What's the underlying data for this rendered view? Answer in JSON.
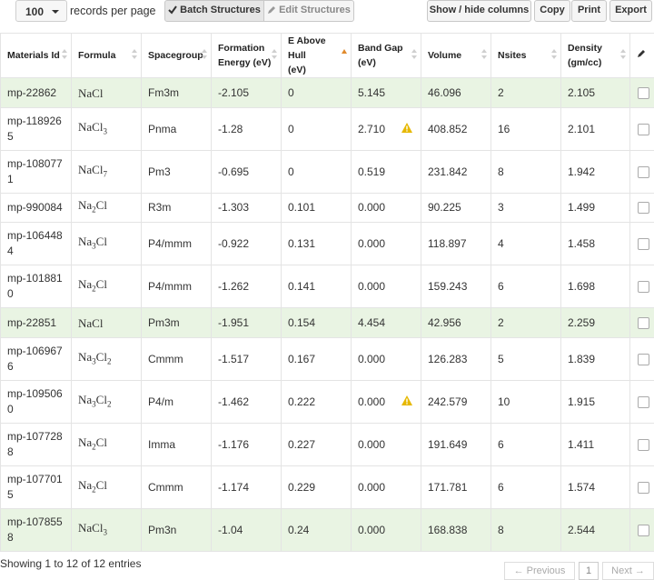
{
  "toolbar": {
    "page_length": "100",
    "page_length_label": "records per page",
    "batch_label": "Batch Structures",
    "edit_label": "Edit Structures",
    "columns_label": "Show / hide columns",
    "copy_label": "Copy",
    "print_label": "Print",
    "export_label": "Export"
  },
  "headers": {
    "id": "Materials Id",
    "formula": "Formula",
    "spacegroup": "Spacegroup",
    "formation1": "Formation",
    "formation2": "Energy (eV)",
    "ehull1": "E Above Hull",
    "ehull2": "(eV)",
    "gap1": "Band Gap",
    "gap2": "(eV)",
    "volume": "Volume",
    "nsites": "Nsites",
    "density1": "Density",
    "density2": "(gm/cc)"
  },
  "colors": {
    "highlight_row": "#e9f4e3",
    "sort_active": "#e08a2c",
    "warning": "#e6b800"
  },
  "rows": [
    {
      "id1": "mp-22862",
      "id2": "",
      "el1": "NaCl",
      "s1": "",
      "el2": "",
      "s2": "",
      "sg": "Fm3m",
      "fe": "-2.105",
      "eh": "0",
      "bg": "5.145",
      "warn": false,
      "vol": "46.096",
      "ns": "2",
      "den": "2.105",
      "hl": true
    },
    {
      "id1": "mp-118926",
      "id2": "5",
      "el1": "NaCl",
      "s1": "3",
      "el2": "",
      "s2": "",
      "sg": "Pnma",
      "fe": "-1.28",
      "eh": "0",
      "bg": "2.710",
      "warn": true,
      "vol": "408.852",
      "ns": "16",
      "den": "2.101",
      "hl": false
    },
    {
      "id1": "mp-108077",
      "id2": "1",
      "el1": "NaCl",
      "s1": "7",
      "el2": "",
      "s2": "",
      "sg": "Pm3",
      "fe": "-0.695",
      "eh": "0",
      "bg": "0.519",
      "warn": false,
      "vol": "231.842",
      "ns": "8",
      "den": "1.942",
      "hl": false
    },
    {
      "id1": "mp-990084",
      "id2": "",
      "el1": "Na",
      "s1": "2",
      "el2": "Cl",
      "s2": "",
      "sg": "R3m",
      "fe": "-1.303",
      "eh": "0.101",
      "bg": "0.000",
      "warn": false,
      "vol": "90.225",
      "ns": "3",
      "den": "1.499",
      "hl": false
    },
    {
      "id1": "mp-106448",
      "id2": "4",
      "el1": "Na",
      "s1": "3",
      "el2": "Cl",
      "s2": "",
      "sg": "P4/mmm",
      "fe": "-0.922",
      "eh": "0.131",
      "bg": "0.000",
      "warn": false,
      "vol": "118.897",
      "ns": "4",
      "den": "1.458",
      "hl": false
    },
    {
      "id1": "mp-101881",
      "id2": "0",
      "el1": "Na",
      "s1": "2",
      "el2": "Cl",
      "s2": "",
      "sg": "P4/mmm",
      "fe": "-1.262",
      "eh": "0.141",
      "bg": "0.000",
      "warn": false,
      "vol": "159.243",
      "ns": "6",
      "den": "1.698",
      "hl": false
    },
    {
      "id1": "mp-22851",
      "id2": "",
      "el1": "NaCl",
      "s1": "",
      "el2": "",
      "s2": "",
      "sg": "Pm3m",
      "fe": "-1.951",
      "eh": "0.154",
      "bg": "4.454",
      "warn": false,
      "vol": "42.956",
      "ns": "2",
      "den": "2.259",
      "hl": true
    },
    {
      "id1": "mp-106967",
      "id2": "6",
      "el1": "Na",
      "s1": "3",
      "el2": "Cl",
      "s2": "2",
      "sg": "Cmmm",
      "fe": "-1.517",
      "eh": "0.167",
      "bg": "0.000",
      "warn": false,
      "vol": "126.283",
      "ns": "5",
      "den": "1.839",
      "hl": false
    },
    {
      "id1": "mp-109506",
      "id2": "0",
      "el1": "Na",
      "s1": "3",
      "el2": "Cl",
      "s2": "2",
      "sg": "P4/m",
      "fe": "-1.462",
      "eh": "0.222",
      "bg": "0.000",
      "warn": true,
      "vol": "242.579",
      "ns": "10",
      "den": "1.915",
      "hl": false
    },
    {
      "id1": "mp-107728",
      "id2": "8",
      "el1": "Na",
      "s1": "2",
      "el2": "Cl",
      "s2": "",
      "sg": "Imma",
      "fe": "-1.176",
      "eh": "0.227",
      "bg": "0.000",
      "warn": false,
      "vol": "191.649",
      "ns": "6",
      "den": "1.411",
      "hl": false
    },
    {
      "id1": "mp-107701",
      "id2": "5",
      "el1": "Na",
      "s1": "2",
      "el2": "Cl",
      "s2": "",
      "sg": "Cmmm",
      "fe": "-1.174",
      "eh": "0.229",
      "bg": "0.000",
      "warn": false,
      "vol": "171.781",
      "ns": "6",
      "den": "1.574",
      "hl": false
    },
    {
      "id1": "mp-107855",
      "id2": "8",
      "el1": "NaCl",
      "s1": "3",
      "el2": "",
      "s2": "",
      "sg": "Pm3n",
      "fe": "-1.04",
      "eh": "0.24",
      "bg": "0.000",
      "warn": false,
      "vol": "168.838",
      "ns": "8",
      "den": "2.544",
      "hl": true
    }
  ],
  "footer": {
    "info": "Showing 1 to 12 of 12 entries",
    "prev": "← Previous",
    "page": "1",
    "next": "Next →"
  }
}
